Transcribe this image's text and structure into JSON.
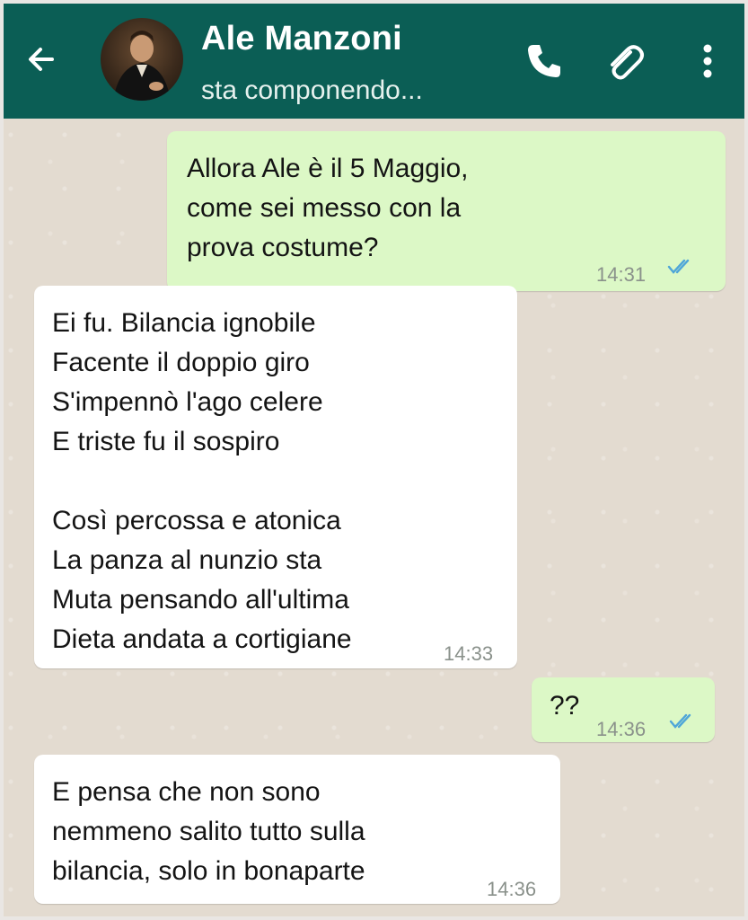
{
  "header": {
    "contact_name": "Ale Manzoni",
    "status": "sta componendo...",
    "icons": [
      "back-arrow-icon",
      "phone-icon",
      "paperclip-icon",
      "more-vert-icon"
    ],
    "color": "#0b5e55"
  },
  "messages": [
    {
      "direction": "out",
      "text": "Allora Ale è il 5 Maggio,\ncome sei messo con la\nprova costume?",
      "time": "14:31",
      "read": true
    },
    {
      "direction": "in",
      "text": "Ei fu. Bilancia ignobile\nFacente il doppio giro\nS'impennò l'ago celere\nE triste fu il sospiro\n\nCosì percossa e atonica\nLa panza al nunzio sta\nMuta pensando all'ultima\nDieta andata a cortigiane",
      "time": "14:33"
    },
    {
      "direction": "out",
      "text": "??",
      "time": "14:36",
      "read": true
    },
    {
      "direction": "in",
      "text": "E pensa che non sono\nnemmeno salito tutto sulla\nbilancia, solo in bonaparte",
      "time": "14:36"
    }
  ],
  "colors": {
    "outgoing_bubble": "#dcf8c6",
    "incoming_bubble": "#ffffff",
    "read_ticks": "#4fa6d8"
  }
}
